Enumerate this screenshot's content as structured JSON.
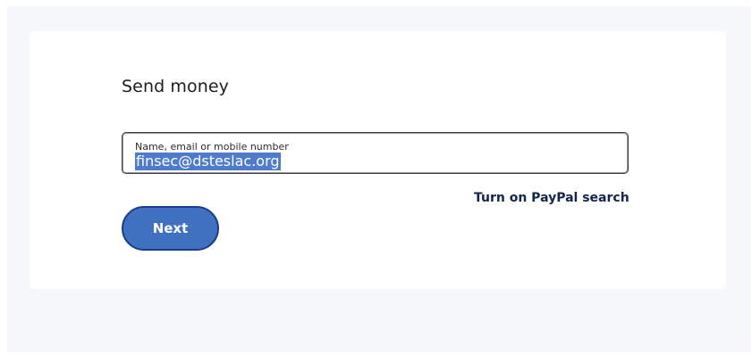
{
  "send_money": {
    "title": "Send money",
    "recipient_field": {
      "label": "Name, email or mobile number",
      "value": "finsec@dsteslac.org",
      "value_selected": true
    },
    "paypal_search_link": "Turn on PayPal search",
    "next_button": "Next"
  },
  "colors": {
    "page_background": "#f5f7fa",
    "card_background": "#ffffff",
    "selection_highlight": "#4f7bcc",
    "primary_button": "#4070c0",
    "link_text": "#14254a"
  }
}
